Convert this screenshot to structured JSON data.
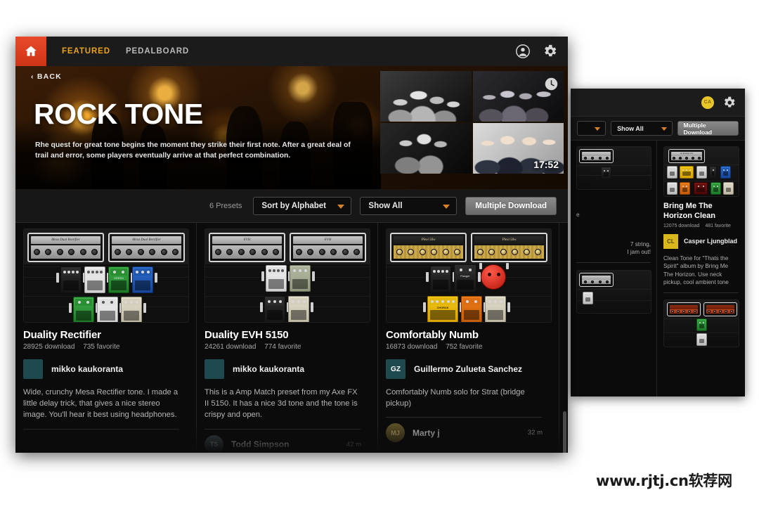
{
  "watermark": "www.rjtj.cn软荐网",
  "main_window": {
    "topbar": {
      "home_icon": "home-icon",
      "nav": [
        {
          "label": "FEATURED",
          "active": true
        },
        {
          "label": "PEDALBOARD",
          "active": false
        }
      ],
      "account_icon": "account-circle-icon",
      "settings_icon": "gear-icon"
    },
    "hero": {
      "back_label": "‹ BACK",
      "title": "ROCK TONE",
      "subtitle": "Rhe quest for great tone begins the moment they strike their first note. After a great deal of trail and error, some players eventually arrive at that perfect combination.",
      "timestamp": "17:52",
      "clock_icon": "clock-icon",
      "thumbnails": [
        "band-photo-1",
        "band-photo-2",
        "band-photo-3",
        "band-photo-4"
      ]
    },
    "controls": {
      "presets_count": "6 Presets",
      "sort_select": "Sort by Alphabet",
      "filter_select": "Show All",
      "multiple_download": "Multiple Download"
    },
    "cards": [
      {
        "title": "Duality Rectifier",
        "downloads": "28925 download",
        "favorites": "735 favorite",
        "author": "mikko kaukoranta",
        "author_initials": "",
        "description": "Wide, crunchy Mesa Rectifier tone. I made a little delay trick, that gives a nice stereo image. You'll hear it best using headphones.",
        "amp_label": "Mesa Dual Rectifier",
        "comment": {
          "name": "",
          "time": ""
        }
      },
      {
        "title": "Duality EVH 5150",
        "downloads": "24261 download",
        "favorites": "774 favorite",
        "author": "mikko kaukoranta",
        "author_initials": "",
        "description": "This is a Amp Match preset from my Axe FX II 5150. It has a nice 3d tone and the tone is crispy and open.",
        "amp_label": "EVH",
        "comment": {
          "name": "Todd Simpson",
          "time": "42 m",
          "initials": "TS"
        }
      },
      {
        "title": "Comfortably Numb",
        "downloads": "16873 download",
        "favorites": "752 favorite",
        "author": "Guillermo Zulueta Sanchez",
        "author_initials": "GZ",
        "description": "Comfortably Numb solo for Strat (bridge pickup)",
        "amp_label": "Plexi 50w",
        "comment": {
          "name": "Marty j",
          "time": "32 m",
          "initials": "MJ"
        }
      }
    ]
  },
  "back_window": {
    "header": {
      "avatar_initials": "CA",
      "settings_icon": "gear-icon"
    },
    "toolbar": {
      "sort_select": "",
      "filter_select": "Show All",
      "multiple_download": "Multiple Download"
    },
    "left_column": {
      "fragment_1": "e",
      "fragment_2": "7 string,",
      "fragment_3": "I jam out!"
    },
    "card": {
      "title": "Bring Me The Horizon Clean",
      "downloads": "12075 download",
      "favorites": "481 favorite",
      "author": "Casper Ljungblad",
      "author_initials": "CL",
      "description": "Clean Tone for \"Thats the Spirit\" album by Bring Me The Horizon. Use neck pickup, cool ambient tone",
      "amp_label": "AC Boutique Trio"
    }
  }
}
